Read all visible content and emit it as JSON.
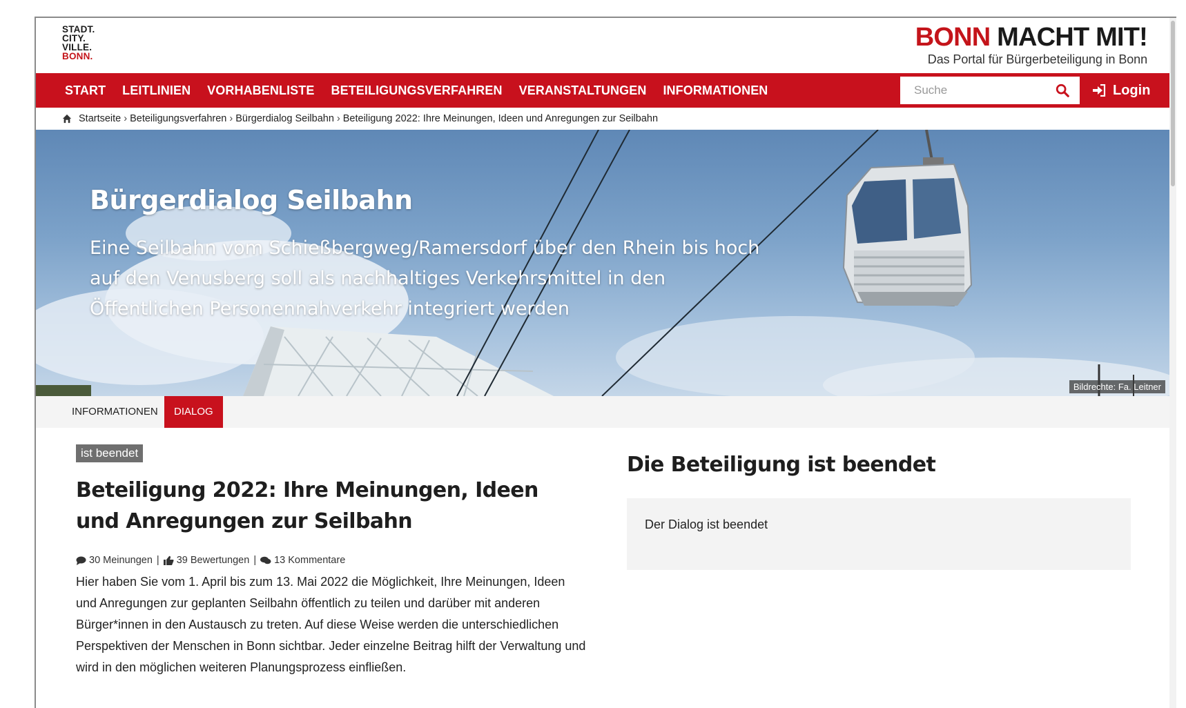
{
  "logo": {
    "lines": [
      "STADT.",
      "CITY.",
      "VILLE."
    ],
    "red_line": "BONN."
  },
  "brand": {
    "title_red": "BONN",
    "title_dark": "MACHT MIT!",
    "subtitle": "Das Portal für Bürgerbeteiligung in Bonn"
  },
  "nav": {
    "items": [
      "START",
      "LEITLINIEN",
      "VORHABENLISTE",
      "BETEILIGUNGSVERFAHREN",
      "VERANSTALTUNGEN",
      "INFORMATIONEN"
    ],
    "search_placeholder": "Suche",
    "login_label": "Login"
  },
  "breadcrumb": {
    "items": [
      "Startseite",
      "Beteiligungsverfahren",
      "Bürgerdialog Seilbahn",
      "Beteiligung 2022: Ihre Meinungen, Ideen und Anregungen zur Seilbahn"
    ],
    "separator": "›"
  },
  "hero": {
    "title": "Bürgerdialog Seilbahn",
    "subtitle": "Eine Seilbahn vom Schießbergweg/Ramersdorf über den Rhein bis hoch auf den Venusberg soll als nachhaltiges Verkehrsmittel in den Öffentlichen Personennahverkehr integriert werden",
    "credit": "Bildrechte: Fa. Leitner"
  },
  "tabs": [
    {
      "label": "Informationen",
      "active": false
    },
    {
      "label": "Dialog",
      "active": true
    }
  ],
  "main": {
    "status_badge": "ist beendet",
    "title": "Beteiligung 2022: Ihre Meinungen, Ideen und Anregungen zur Seilbahn",
    "meta": {
      "opinions": "30 Meinungen",
      "ratings": "39 Bewertungen",
      "comments": "13 Kommentare",
      "separator": "|"
    },
    "description": "Hier haben Sie vom 1. April bis zum 13. Mai 2022 die Möglichkeit, Ihre Meinungen, Ideen und Anregungen zur geplanten Seilbahn öffentlich zu teilen und darüber mit anderen Bürger*innen in den Austausch zu treten. Auf diese Weise werden die unterschiedlichen Perspektiven der Menschen in Bonn sichtbar. Jeder einzelne Beitrag hilft der Verwaltung und wird in den möglichen weiteren Planungsprozess einfließen."
  },
  "sidebar": {
    "heading": "Die Beteiligung ist beendet",
    "box_text": "Der Dialog ist beendet"
  },
  "colors": {
    "brand_red": "#c8111d",
    "badge_gray": "#6f6f6f",
    "box_gray": "#f3f3f3"
  },
  "icons": [
    "home-icon",
    "search-icon",
    "login-icon",
    "comment-icon",
    "thumbs-up-icon",
    "comments-icon"
  ]
}
